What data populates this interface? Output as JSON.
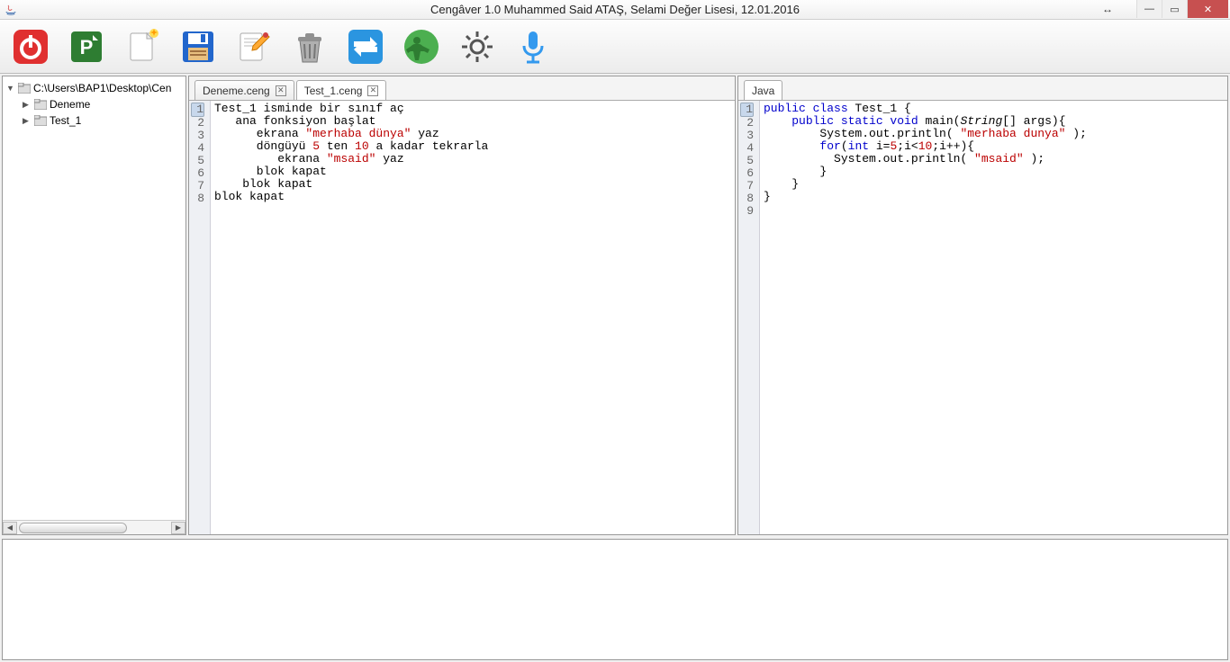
{
  "window": {
    "title": "Cengâver 1.0  Muhammed Said ATAŞ, Selami Değer Lisesi, 12.01.2016"
  },
  "tree": {
    "root": "C:\\Users\\BAP1\\Desktop\\Cen",
    "items": [
      "Deneme",
      "Test_1"
    ]
  },
  "left_editor": {
    "tabs": [
      {
        "label": "Deneme.ceng",
        "active": false
      },
      {
        "label": "Test_1.ceng",
        "active": true
      }
    ],
    "lines": [
      {
        "n": 1,
        "segs": [
          [
            "Test_1 isminde bir sınıf aç",
            "kw-black"
          ]
        ]
      },
      {
        "n": 2,
        "segs": [
          [
            "   ana fonksiyon başlat",
            "kw-black"
          ]
        ]
      },
      {
        "n": 3,
        "segs": [
          [
            "      ekrana ",
            "kw-black"
          ],
          [
            "\"merhaba dünya\"",
            "str-red"
          ],
          [
            " yaz",
            "kw-black"
          ]
        ]
      },
      {
        "n": 4,
        "segs": [
          [
            "      döngüyü ",
            "kw-black"
          ],
          [
            "5",
            "num-red"
          ],
          [
            " ten ",
            "kw-black"
          ],
          [
            "10",
            "num-red"
          ],
          [
            " a kadar tekrarla",
            "kw-black"
          ]
        ]
      },
      {
        "n": 5,
        "segs": [
          [
            "         ekrana ",
            "kw-black"
          ],
          [
            "\"msaid\"",
            "str-red"
          ],
          [
            " yaz",
            "kw-black"
          ]
        ]
      },
      {
        "n": 6,
        "segs": [
          [
            "      blok kapat",
            "kw-black"
          ]
        ]
      },
      {
        "n": 7,
        "segs": [
          [
            "    blok kapat",
            "kw-black"
          ]
        ]
      },
      {
        "n": 8,
        "segs": [
          [
            "blok kapat",
            "kw-black"
          ]
        ]
      }
    ]
  },
  "right_editor": {
    "tabs": [
      {
        "label": "Java",
        "active": true
      }
    ],
    "lines": [
      {
        "n": 1,
        "segs": [
          [
            "public class ",
            "kw-blue"
          ],
          [
            "Test_1 {",
            "kw-black"
          ]
        ]
      },
      {
        "n": 2,
        "segs": [
          [
            "    ",
            "kw-black"
          ],
          [
            "public static void ",
            "kw-blue"
          ],
          [
            "main(",
            "kw-black"
          ],
          [
            "String",
            "kw-italic"
          ],
          [
            "[] args){",
            "kw-black"
          ]
        ]
      },
      {
        "n": 3,
        "segs": [
          [
            "        System.out.println( ",
            "kw-black"
          ],
          [
            "\"merhaba dunya\"",
            "str-red"
          ],
          [
            " );",
            "kw-black"
          ]
        ]
      },
      {
        "n": 4,
        "segs": [
          [
            "        ",
            "kw-black"
          ],
          [
            "for",
            "kw-blue"
          ],
          [
            "(",
            "kw-black"
          ],
          [
            "int ",
            "kw-blue"
          ],
          [
            "i=",
            "kw-black"
          ],
          [
            "5",
            "num-red"
          ],
          [
            ";i<",
            "kw-black"
          ],
          [
            "10",
            "num-red"
          ],
          [
            ";i++){",
            "kw-black"
          ]
        ]
      },
      {
        "n": 5,
        "segs": [
          [
            "          System.out.println( ",
            "kw-black"
          ],
          [
            "\"msaid\"",
            "str-red"
          ],
          [
            " );",
            "kw-black"
          ]
        ]
      },
      {
        "n": 6,
        "segs": [
          [
            "        }",
            "kw-black"
          ]
        ]
      },
      {
        "n": 7,
        "segs": [
          [
            "    }",
            "kw-black"
          ]
        ]
      },
      {
        "n": 8,
        "segs": [
          [
            "}",
            "kw-black"
          ]
        ]
      },
      {
        "n": 9,
        "segs": [
          [
            "",
            "kw-black"
          ]
        ]
      }
    ]
  },
  "toolbar_icons": [
    "power",
    "project",
    "new-file",
    "save",
    "edit",
    "delete",
    "transfer",
    "run",
    "settings",
    "microphone"
  ]
}
